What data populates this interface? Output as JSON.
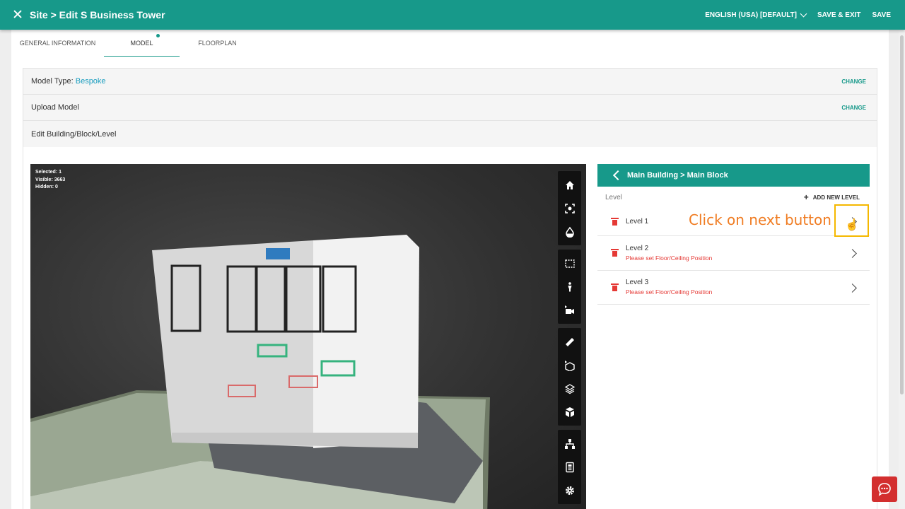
{
  "topbar": {
    "title": "Site > Edit S Business Tower",
    "language": "ENGLISH (USA) [DEFAULT]",
    "save_exit": "SAVE & EXIT",
    "save": "SAVE"
  },
  "tabs": [
    "GENERAL INFORMATION",
    "MODEL",
    "FLOORPLAN"
  ],
  "sections": {
    "model_type_label": "Model Type:",
    "model_type_value": "Bespoke",
    "upload_model": "Upload Model",
    "edit_building": "Edit Building/Block/Level",
    "change": "CHANGE"
  },
  "viewer": {
    "selected": "Selected: 1",
    "visible": "Visible: 3663",
    "hidden": "Hidden: 0"
  },
  "panel": {
    "breadcrumb": "Main Building > Main Block",
    "level_label": "Level",
    "add_new": "ADD NEW LEVEL",
    "levels": [
      {
        "name": "Level 1",
        "warning": ""
      },
      {
        "name": "Level 2",
        "warning": "Please set Floor/Ceiling Position"
      },
      {
        "name": "Level 3",
        "warning": "Please set Floor/Ceiling Position"
      }
    ]
  },
  "annotation": "Click on next button",
  "colors": {
    "primary": "#17998a",
    "error": "#e53935",
    "accent": "#f5b800"
  }
}
